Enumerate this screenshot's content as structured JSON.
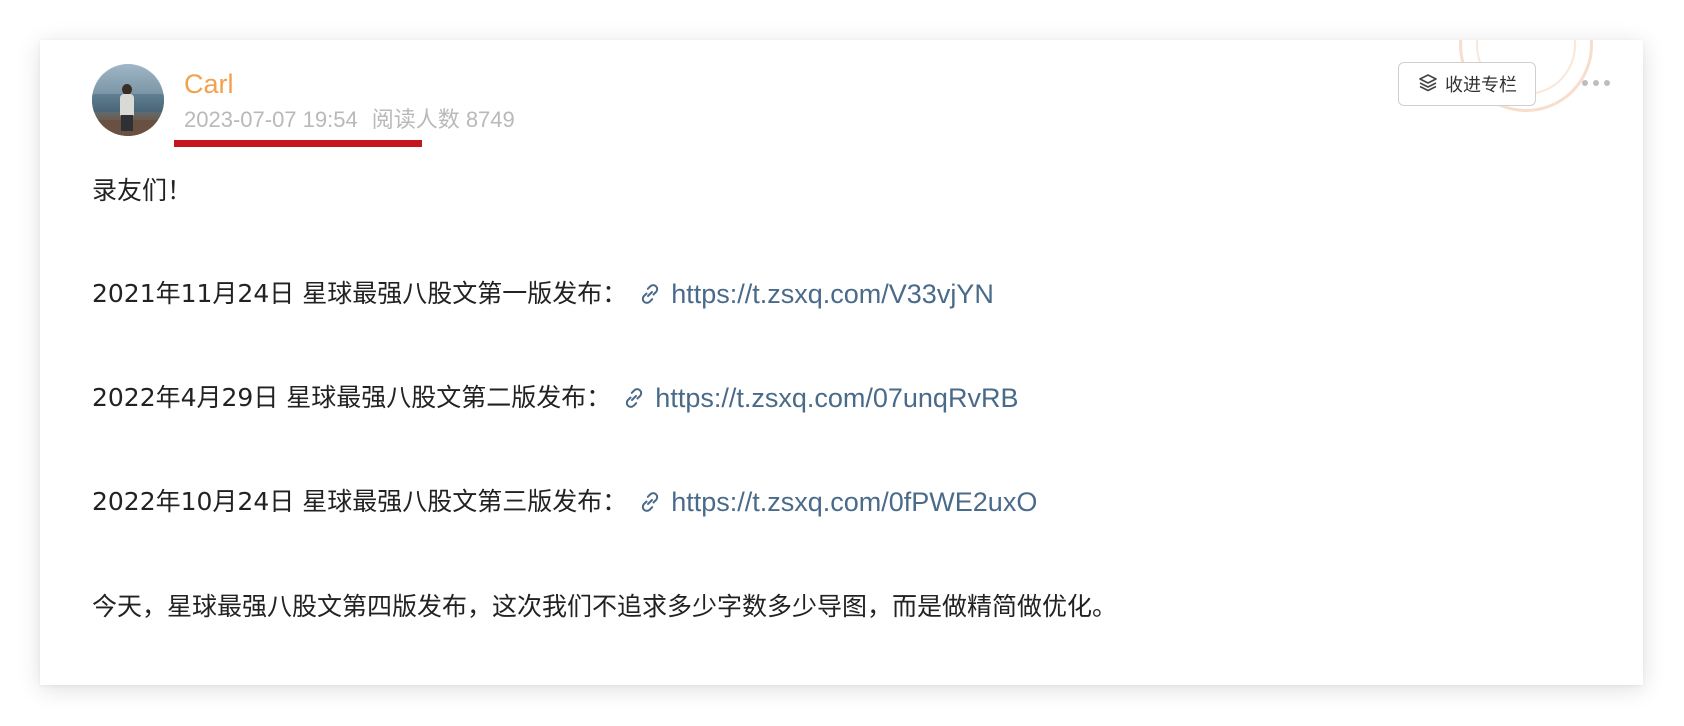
{
  "post": {
    "author": "Carl",
    "timestamp": "2023-07-07 19:54",
    "reads": "阅读人数 8749",
    "collect_label": "收进专栏"
  },
  "paragraphs": [
    {
      "text": "录友们！"
    },
    {
      "text": "2021年11月24日 星球最强八股文第一版发布：",
      "link": "https://t.zsxq.com/V33vjYN"
    },
    {
      "text": "2022年4月29日 星球最强八股文第二版发布：",
      "link": "https://t.zsxq.com/07unqRvRB"
    },
    {
      "text": "2022年10月24日 星球最强八股文第三版发布：",
      "link": "https://t.zsxq.com/0fPWE2uxO"
    },
    {
      "text": "今天，星球最强八股文第四版发布，这次我们不追求多少字数多少导图，而是做精简做优化。"
    }
  ],
  "colors": {
    "author": "#f2a14e",
    "meta": "#b9b9b9",
    "link": "#4a6a8a",
    "annotation_underline": "#c4161c"
  },
  "icons": {
    "collect": "column-stack-icon",
    "link": "link-chain-icon",
    "more": "more-dots-icon"
  }
}
